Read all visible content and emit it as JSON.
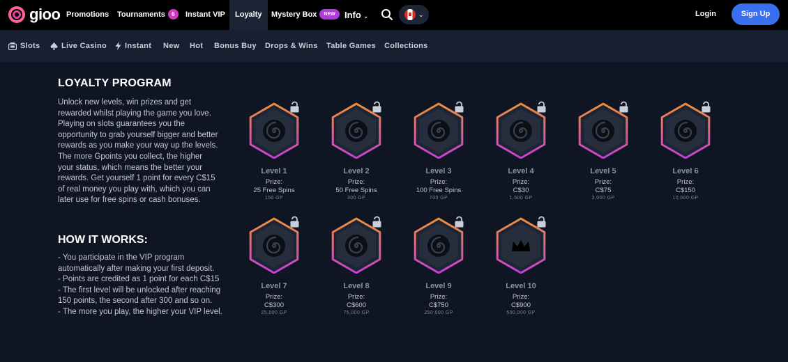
{
  "brand": {
    "name": "gioo"
  },
  "nav": {
    "promotions": "Promotions",
    "tournaments": "Tournaments",
    "tournaments_count": "6",
    "instant_vip": "Instant VIP",
    "loyalty": "Loyalty",
    "mystery_box": "Mystery Box",
    "mystery_badge": "NEW",
    "info": "Info",
    "login": "Login",
    "signup": "Sign Up"
  },
  "categories": {
    "slots": "Slots",
    "live_casino": "Live Casino",
    "instant": "Instant",
    "new": "New",
    "hot": "Hot",
    "bonus_buy": "Bonus Buy",
    "drops_wins": "Drops & Wins",
    "table_games": "Table Games",
    "collections": "Collections"
  },
  "loyalty": {
    "title": "LOYALTY PROGRAM",
    "description": "Unlock new levels, win prizes and get rewarded whilst playing the game you love. Playing on slots guarantees you the opportunity to grab yourself bigger and better rewards as you make your way up the levels. The more Gpoints you collect, the higher your status, which means the better your rewards. Get yourself 1 point for every C$15 of real money you play with, which you can later use for free spins or cash bonuses."
  },
  "how": {
    "title": "HOW IT WORKS:",
    "items": [
      "- You participate in the VIP program automatically after making your first deposit.",
      "- Points are credited as 1 point for each C$15",
      "- The first level will be unlocked after reaching 150 points, the second after 300 and so on.",
      "- The more you play, the higher your VIP level."
    ]
  },
  "levels": [
    {
      "name": "Level 1",
      "prize_label": "Prize:",
      "prize": "25 Free Spins",
      "gp": "150 GP",
      "icon": "spiral-icon"
    },
    {
      "name": "Level 2",
      "prize_label": "Prize:",
      "prize": "50 Free Spins",
      "gp": "300 GP",
      "icon": "spiral-icon"
    },
    {
      "name": "Level 3",
      "prize_label": "Prize:",
      "prize": "100 Free Spins",
      "gp": "700 GP",
      "icon": "spiral-icon"
    },
    {
      "name": "Level 4",
      "prize_label": "Prize:",
      "prize": "C$30",
      "gp": "1,500 GP",
      "icon": "spiral-icon"
    },
    {
      "name": "Level 5",
      "prize_label": "Prize:",
      "prize": "C$75",
      "gp": "3,000 GP",
      "icon": "spiral-icon"
    },
    {
      "name": "Level 6",
      "prize_label": "Prize:",
      "prize": "C$150",
      "gp": "10,000 GP",
      "icon": "spiral-icon"
    },
    {
      "name": "Level 7",
      "prize_label": "Prize:",
      "prize": "C$300",
      "gp": "25,000 GP",
      "icon": "spiral-icon"
    },
    {
      "name": "Level 8",
      "prize_label": "Prize:",
      "prize": "C$600",
      "gp": "75,000 GP",
      "icon": "spiral-icon"
    },
    {
      "name": "Level 9",
      "prize_label": "Prize:",
      "prize": "C$750",
      "gp": "250,000 GP",
      "icon": "spiral-icon"
    },
    {
      "name": "Level 10",
      "prize_label": "Prize:",
      "prize": "C$900",
      "gp": "500,000 GP",
      "icon": "crown-icon"
    }
  ],
  "colors": {
    "accent_blue": "#3a6ff2",
    "badge_pink": "#d43ac0",
    "hex_gradient_top": "#f0913a",
    "hex_gradient_bottom": "#c43fd6"
  }
}
